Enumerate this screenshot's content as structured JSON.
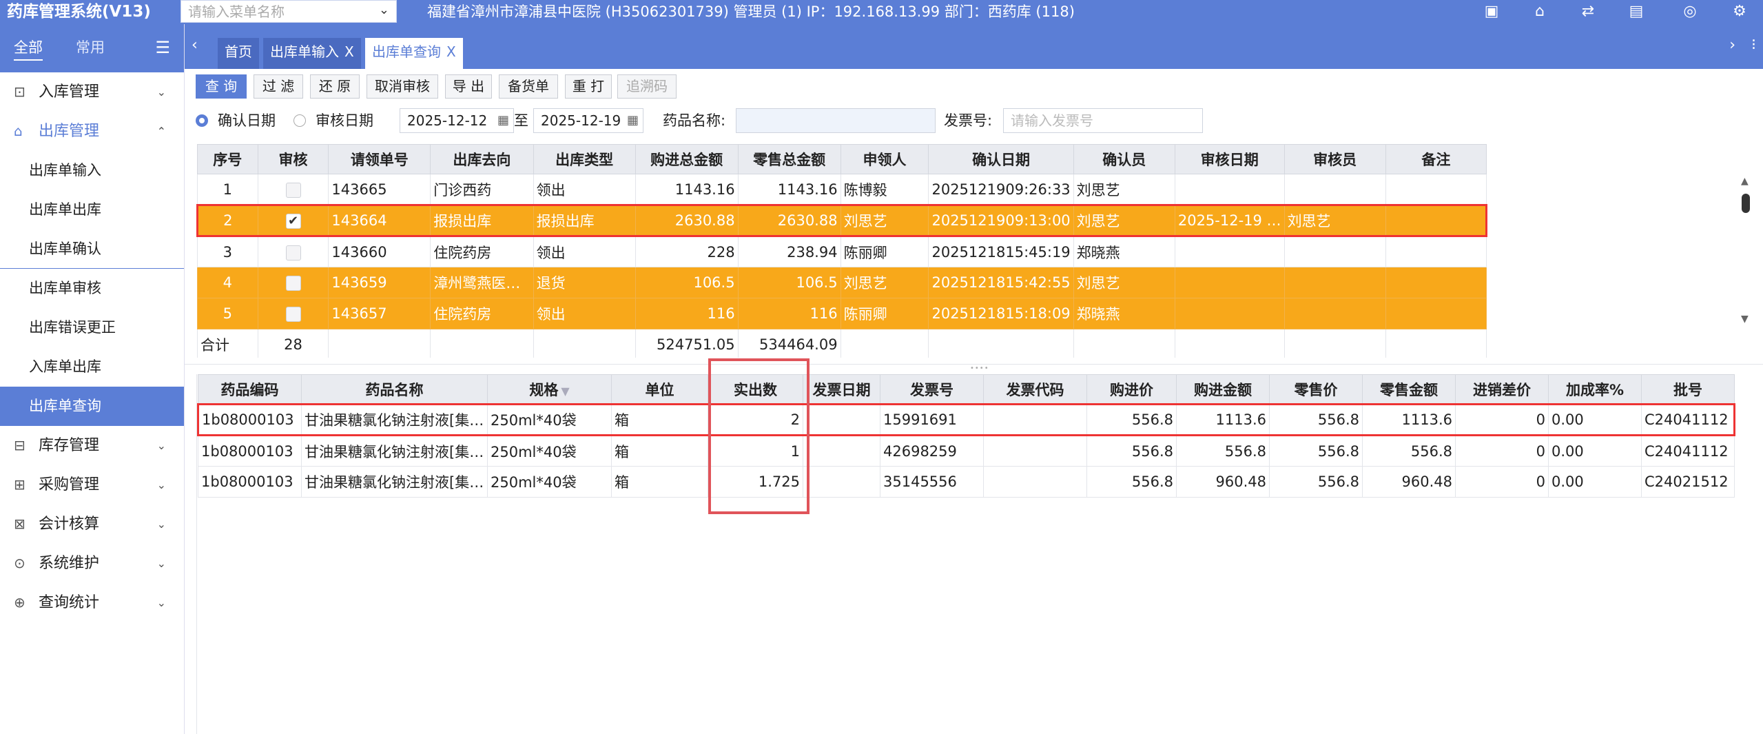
{
  "app": {
    "title": "药库管理系统(V13)",
    "menu_search_placeholder": "请输入菜单名称",
    "env_info": "福建省漳州市漳浦县中医院 (H35062301739) 管理员 (1) IP：192.168.13.99 部门：西药库 (118)",
    "top_icons": [
      "screen-icon",
      "presentation-icon",
      "switch-icon",
      "document-icon",
      "shield-icon",
      "gear-icon"
    ]
  },
  "sidebar": {
    "tab_all": "全部",
    "tab_common": "常用",
    "groups": [
      {
        "label": "入库管理",
        "icon": "inbound-icon",
        "expanded": false
      },
      {
        "label": "出库管理",
        "icon": "outbound-icon",
        "expanded": true,
        "items": [
          "出库单输入",
          "出库单出库",
          "出库单确认",
          "出库单审核",
          "出库错误更正",
          "入库单出库",
          "出库单查询"
        ],
        "active_item": "出库单查询"
      },
      {
        "label": "库存管理",
        "icon": "stock-icon",
        "expanded": false
      },
      {
        "label": "采购管理",
        "icon": "purchase-icon",
        "expanded": false
      },
      {
        "label": "会计核算",
        "icon": "accounting-icon",
        "expanded": false
      },
      {
        "label": "系统维护",
        "icon": "system-icon",
        "expanded": false
      },
      {
        "label": "查询统计",
        "icon": "stats-icon",
        "expanded": false
      }
    ]
  },
  "tabs": {
    "items": [
      {
        "label": "首页",
        "closable": false,
        "active": false
      },
      {
        "label": "出库单输入",
        "closable": true,
        "active": false
      },
      {
        "label": "出库单查询",
        "closable": true,
        "active": true
      }
    ],
    "close_glyph": "X"
  },
  "toolbar": {
    "query": "查 询",
    "filter": "过 滤",
    "restore": "还 原",
    "cancel_audit": "取消审核",
    "export": "导 出",
    "prepare": "备货单",
    "reprint": "重 打",
    "trace": "追溯码"
  },
  "filters": {
    "confirm_date_label": "确认日期",
    "audit_date_label": "审核日期",
    "date_from": "2025-12-12",
    "date_sep": "至",
    "date_to": "2025-12-19",
    "drug_name_label": "药品名称:",
    "drug_name_value": "",
    "invoice_label": "发票号:",
    "invoice_placeholder": "请输入发票号"
  },
  "upper_table": {
    "columns": [
      "序号",
      "审核",
      "请领单号",
      "出库去向",
      "出库类型",
      "购进总金额",
      "零售总金额",
      "申领人",
      "确认日期",
      "确认员",
      "审核日期",
      "审核员",
      "备注"
    ],
    "rows": [
      {
        "no": "1",
        "audited": false,
        "req_no": "143665",
        "dest": "门诊西药",
        "type": "领出",
        "purchase_total": "1143.16",
        "retail_total": "1143.16",
        "applicant": "陈博毅",
        "confirm_date": "2025121909:26:33",
        "confirmer": "刘思艺",
        "audit_date": "",
        "auditor": "",
        "remark": "",
        "highlight": false,
        "selected": false
      },
      {
        "no": "2",
        "audited": true,
        "req_no": "143664",
        "dest": "报损出库",
        "type": "报损出库",
        "purchase_total": "2630.88",
        "retail_total": "2630.88",
        "applicant": "刘思艺",
        "confirm_date": "2025121909:13:00",
        "confirmer": "刘思艺",
        "audit_date": "2025-12-19 …",
        "auditor": "刘思艺",
        "remark": "",
        "highlight": true,
        "selected": true
      },
      {
        "no": "3",
        "audited": false,
        "req_no": "143660",
        "dest": "住院药房",
        "type": "领出",
        "purchase_total": "228",
        "retail_total": "238.94",
        "applicant": "陈丽卿",
        "confirm_date": "2025121815:45:19",
        "confirmer": "郑晓燕",
        "audit_date": "",
        "auditor": "",
        "remark": "",
        "highlight": false,
        "selected": false
      },
      {
        "no": "4",
        "audited": false,
        "req_no": "143659",
        "dest": "漳州鹭燕医…",
        "type": "退货",
        "purchase_total": "106.5",
        "retail_total": "106.5",
        "applicant": "刘思艺",
        "confirm_date": "2025121815:42:55",
        "confirmer": "刘思艺",
        "audit_date": "",
        "auditor": "",
        "remark": "",
        "highlight": true,
        "selected": false
      },
      {
        "no": "5",
        "audited": false,
        "req_no": "143657",
        "dest": "住院药房",
        "type": "领出",
        "purchase_total": "116",
        "retail_total": "116",
        "applicant": "陈丽卿",
        "confirm_date": "2025121815:18:09",
        "confirmer": "郑晓燕",
        "audit_date": "",
        "auditor": "",
        "remark": "",
        "highlight": true,
        "selected": false
      }
    ],
    "total": {
      "label": "合计",
      "count": "28",
      "purchase_total": "524751.05",
      "retail_total": "534464.09"
    }
  },
  "lower_table": {
    "columns": [
      "药品编码",
      "药品名称",
      "规格",
      "单位",
      "实出数",
      "发票日期",
      "发票号",
      "发票代码",
      "购进价",
      "购进金额",
      "零售价",
      "零售金额",
      "进销差价",
      "加成率%",
      "批号"
    ],
    "rows": [
      {
        "code": "1b08000103",
        "name": "甘油果糖氯化钠注射液[集…",
        "spec": "250ml*40袋",
        "unit": "箱",
        "qty": "2",
        "inv_date": "",
        "inv_no": "15991691",
        "inv_code": "",
        "price": "556.8",
        "amount": "1113.6",
        "retail_price": "556.8",
        "retail_amount": "1113.6",
        "diff": "0",
        "markup": "0.00",
        "batch": "C24041112",
        "selected": true
      },
      {
        "code": "1b08000103",
        "name": "甘油果糖氯化钠注射液[集…",
        "spec": "250ml*40袋",
        "unit": "箱",
        "qty": "1",
        "inv_date": "",
        "inv_no": "42698259",
        "inv_code": "",
        "price": "556.8",
        "amount": "556.8",
        "retail_price": "556.8",
        "retail_amount": "556.8",
        "diff": "0",
        "markup": "0.00",
        "batch": "C24041112",
        "selected": false
      },
      {
        "code": "1b08000103",
        "name": "甘油果糖氯化钠注射液[集…",
        "spec": "250ml*40袋",
        "unit": "箱",
        "qty": "1.725",
        "inv_date": "",
        "inv_no": "35145556",
        "inv_code": "",
        "price": "556.8",
        "amount": "960.48",
        "retail_price": "556.8",
        "retail_amount": "960.48",
        "diff": "0",
        "markup": "0.00",
        "batch": "C24021512",
        "selected": false
      }
    ]
  },
  "colors": {
    "primary": "#5b7ed6",
    "row_highlight": "#f8a81a",
    "selection_border": "#e33333"
  }
}
